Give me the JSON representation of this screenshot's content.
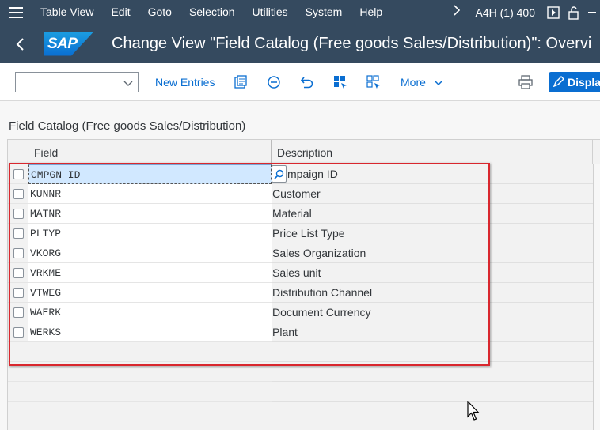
{
  "menubar": {
    "items": [
      {
        "label": "Table View"
      },
      {
        "label": "Edit"
      },
      {
        "label": "Goto"
      },
      {
        "label": "Selection"
      },
      {
        "label": "Utilities"
      },
      {
        "label": "System"
      },
      {
        "label": "Help"
      }
    ],
    "system_info": "A4H (1) 400"
  },
  "titlebar": {
    "logo_text": "SAP",
    "title": "Change View \"Field Catalog (Free goods Sales/Distribution)\": Overvi"
  },
  "toolbar": {
    "combo_value": "",
    "new_entries_label": "New Entries",
    "more_label": "More",
    "display_button_label": "Displa"
  },
  "section": {
    "title": "Field Catalog (Free goods Sales/Distribution)"
  },
  "table": {
    "columns": {
      "field": "Field",
      "description": "Description"
    },
    "rows": [
      {
        "field": "CMPGN_ID",
        "description": "Campaign ID",
        "description_visible": "mpaign ID"
      },
      {
        "field": "KUNNR",
        "description": "Customer"
      },
      {
        "field": "MATNR",
        "description": "Material"
      },
      {
        "field": "PLTYP",
        "description": "Price List Type"
      },
      {
        "field": "VKORG",
        "description": "Sales Organization"
      },
      {
        "field": "VRKME",
        "description": "Sales unit"
      },
      {
        "field": "VTWEG",
        "description": "Distribution Channel"
      },
      {
        "field": "WAERK",
        "description": "Document Currency"
      },
      {
        "field": "WERKS",
        "description": "Plant"
      }
    ]
  },
  "colors": {
    "shell": "#354a5f",
    "accent": "#0a6ed1",
    "highlight_box": "#d9272e"
  }
}
